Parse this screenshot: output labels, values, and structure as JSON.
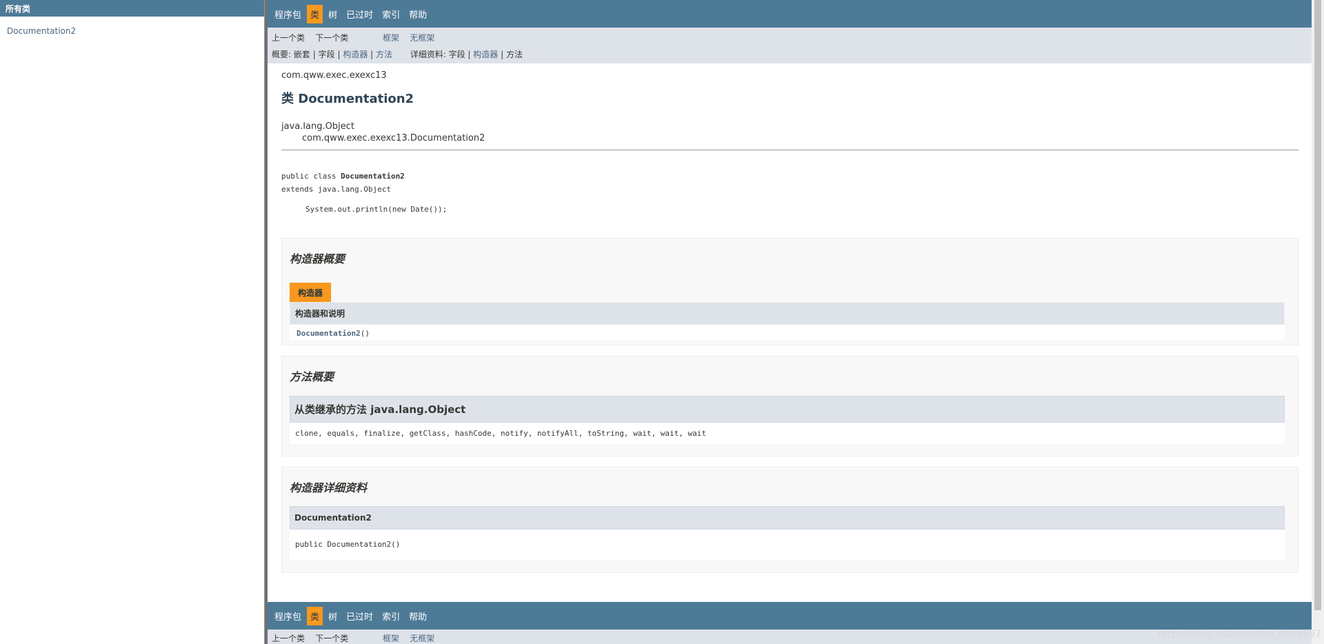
{
  "left_frame": {
    "title": "所有类",
    "items": [
      "Documentation2"
    ]
  },
  "top_nav": {
    "items": [
      {
        "label": "程序包",
        "active": false
      },
      {
        "label": "类",
        "active": true
      },
      {
        "label": "树",
        "active": false
      },
      {
        "label": "已过时",
        "active": false
      },
      {
        "label": "索引",
        "active": false
      },
      {
        "label": "帮助",
        "active": false
      }
    ]
  },
  "sub_nav": {
    "prev_class": "上一个类",
    "next_class": "下一个类",
    "frames": "框架",
    "no_frames": "无框架",
    "summary_label": "概要:",
    "summary_nested": "嵌套",
    "summary_field": "字段",
    "summary_constructor": "构造器",
    "summary_method": "方法",
    "detail_label": "详细资料:",
    "detail_field": "字段",
    "detail_constructor": "构造器",
    "detail_method": "方法",
    "separator": "|"
  },
  "class_info": {
    "package": "com.qww.exec.exexc13",
    "title": "类 Documentation2",
    "inheritance_root": "java.lang.Object",
    "inheritance_child": "com.qww.exec.exexc13.Documentation2",
    "decl_prefix": "public class ",
    "decl_name": "Documentation2",
    "decl_extends": "extends java.lang.Object",
    "comment": "System.out.println(new Date());"
  },
  "constructor_summary": {
    "title": "构造器概要",
    "caption": "构造器",
    "column_header": "构造器和说明",
    "row_name": "Documentation2",
    "row_suffix": "()"
  },
  "method_summary": {
    "title": "方法概要",
    "inherited_header": "从类继承的方法 java.lang.Object",
    "inherited_methods": "clone, equals, finalize, getClass, hashCode, notify, notifyAll, toString, wait, wait, wait"
  },
  "constructor_detail": {
    "title": "构造器详细资料",
    "header": "Documentation2",
    "signature": "public  Documentation2()"
  },
  "watermark": "https://blog.csdn.net/qq_4064897",
  "colors": {
    "nav_bg": "#4d7a97",
    "nav_active": "#f8981d",
    "subnav_bg": "#dee3e9",
    "link": "#4a6782"
  }
}
